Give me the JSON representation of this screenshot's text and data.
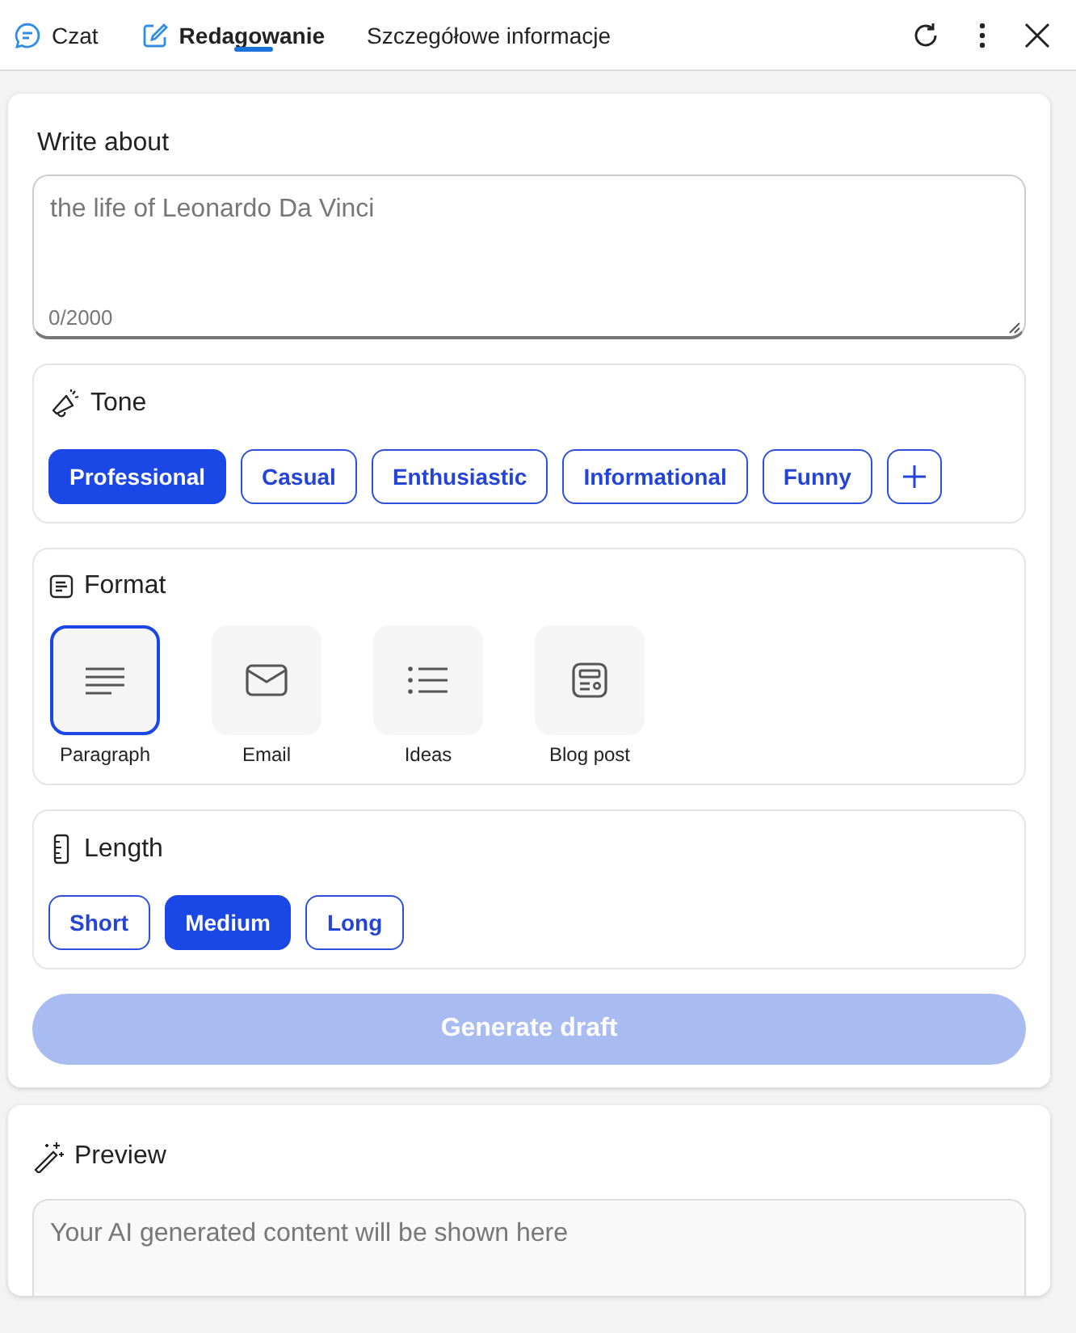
{
  "tabs": [
    {
      "label": "Czat",
      "kind": "chat",
      "selected": false
    },
    {
      "label": "Redagowanie",
      "kind": "compose",
      "selected": true
    },
    {
      "label": "Szczegółowe informacje",
      "kind": "text",
      "selected": false
    }
  ],
  "write_about": {
    "title": "Write about",
    "placeholder": "the life of Leonardo Da Vinci",
    "counter": "0/2000"
  },
  "tone": {
    "title": "Tone",
    "options": [
      {
        "label": "Professional",
        "selected": true
      },
      {
        "label": "Casual",
        "selected": false
      },
      {
        "label": "Enthusiastic",
        "selected": false
      },
      {
        "label": "Informational",
        "selected": false
      },
      {
        "label": "Funny",
        "selected": false
      }
    ]
  },
  "format": {
    "title": "Format",
    "options": [
      {
        "label": "Paragraph",
        "kind": "paragraph",
        "selected": true
      },
      {
        "label": "Email",
        "kind": "email",
        "selected": false
      },
      {
        "label": "Ideas",
        "kind": "ideas",
        "selected": false
      },
      {
        "label": "Blog post",
        "kind": "blog",
        "selected": false
      }
    ]
  },
  "length": {
    "title": "Length",
    "options": [
      {
        "label": "Short",
        "selected": false
      },
      {
        "label": "Medium",
        "selected": true
      },
      {
        "label": "Long",
        "selected": false
      }
    ]
  },
  "generate_button": {
    "label": "Generate draft",
    "disabled": true
  },
  "preview": {
    "title": "Preview",
    "placeholder": "Your AI generated content will be shown here"
  }
}
